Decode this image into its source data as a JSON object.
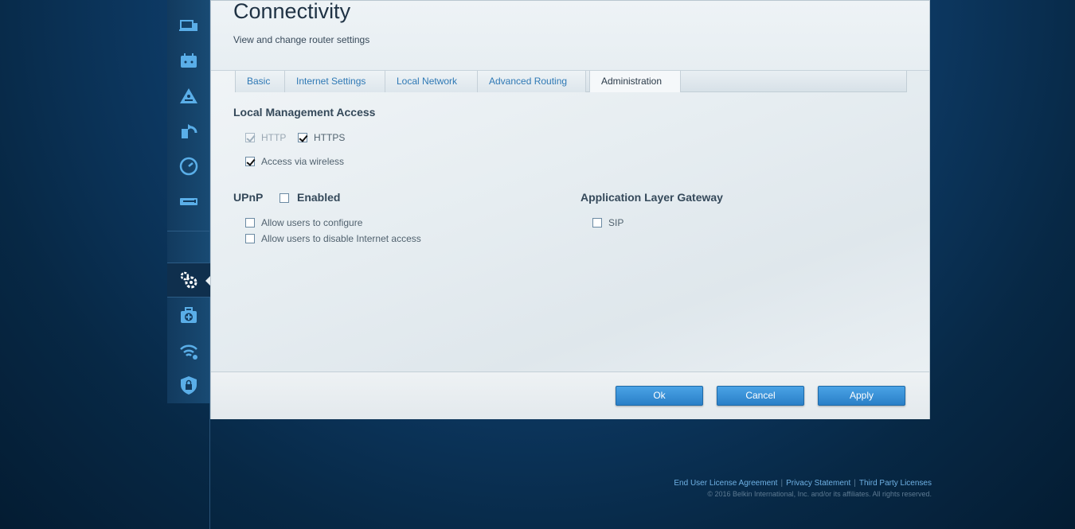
{
  "page": {
    "title": "Connectivity",
    "subtitle": "View and change router settings"
  },
  "sidebar": {
    "items": [
      {
        "icon": "devices-icon"
      },
      {
        "icon": "router-icon"
      },
      {
        "icon": "network-map-icon"
      },
      {
        "icon": "media-prioritization-icon"
      },
      {
        "icon": "speed-test-icon"
      },
      {
        "icon": "usb-storage-icon"
      },
      {
        "icon": "connectivity-gear-icon",
        "active": true
      },
      {
        "icon": "troubleshooting-icon"
      },
      {
        "icon": "wireless-icon"
      },
      {
        "icon": "security-icon"
      }
    ]
  },
  "tabs": [
    {
      "label": "Basic"
    },
    {
      "label": "Internet Settings"
    },
    {
      "label": "Local Network"
    },
    {
      "label": "Advanced Routing"
    },
    {
      "label": "Administration",
      "active": true
    }
  ],
  "local_management": {
    "title": "Local Management Access",
    "http_label": "HTTP",
    "http_checked": true,
    "https_label": "HTTPS",
    "https_checked": true,
    "wireless_label": "Access via wireless",
    "wireless_checked": true
  },
  "upnp": {
    "title": "UPnP",
    "enabled_label": "Enabled",
    "enabled_checked": false,
    "allow_configure_label": "Allow users to configure",
    "allow_disable_label": "Allow users to disable Internet access"
  },
  "alg": {
    "title": "Application Layer Gateway",
    "sip_label": "SIP",
    "sip_checked": false
  },
  "buttons": {
    "ok": "Ok",
    "cancel": "Cancel",
    "apply": "Apply"
  },
  "footer": {
    "eula": "End User License Agreement",
    "privacy": "Privacy Statement",
    "third_party": "Third Party Licenses",
    "copyright": "© 2016 Belkin International, Inc. and/or its affiliates. All rights reserved."
  },
  "colors": {
    "accent": "#2f79b5",
    "button": "#2a7fc7"
  }
}
